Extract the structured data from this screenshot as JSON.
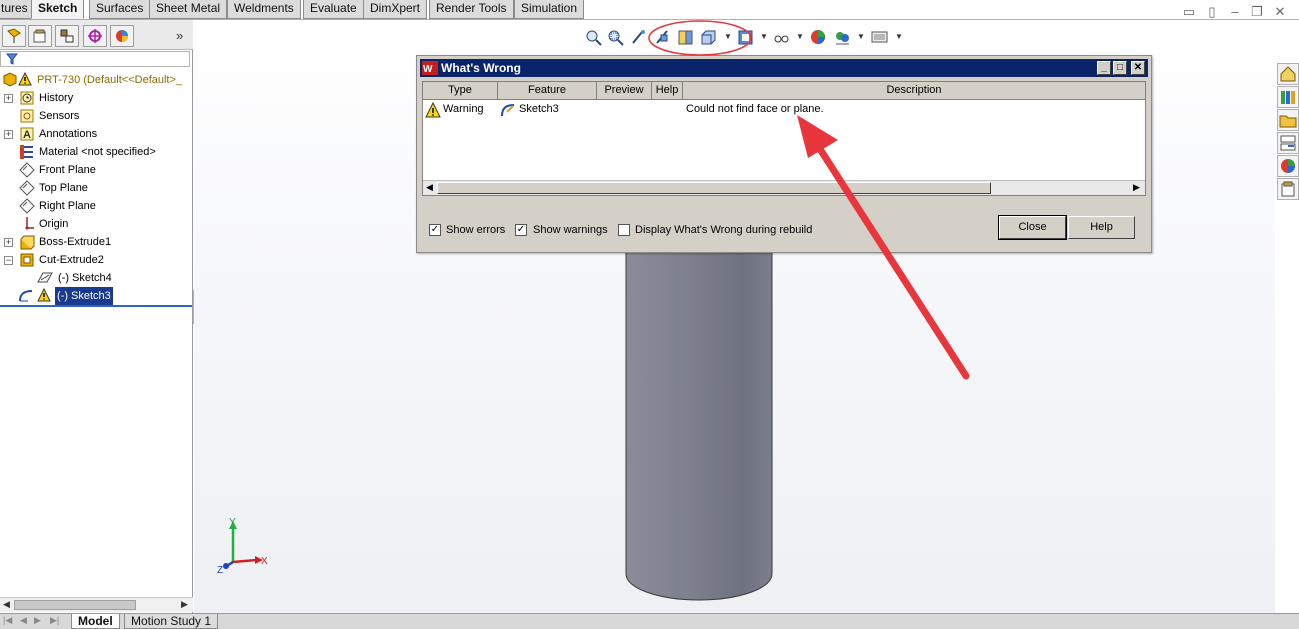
{
  "tabs": [
    {
      "label": "tures"
    },
    {
      "label": "Sketch"
    },
    {
      "label": "Surfaces"
    },
    {
      "label": "Sheet Metal"
    },
    {
      "label": "Weldments"
    },
    {
      "label": "Evaluate"
    },
    {
      "label": "DimXpert"
    },
    {
      "label": "Render Tools"
    },
    {
      "label": "Simulation"
    }
  ],
  "active_tab": "Sketch",
  "feature_tree": {
    "root": "PRT-730  (Default<<Default>_",
    "items": [
      {
        "label": "History",
        "icon": "history-icon"
      },
      {
        "label": "Sensors",
        "icon": "sensors-icon"
      },
      {
        "label": "Annotations",
        "icon": "annotations-icon"
      },
      {
        "label": "Material <not specified>",
        "icon": "material-icon"
      },
      {
        "label": "Front Plane",
        "icon": "plane-icon"
      },
      {
        "label": "Top Plane",
        "icon": "plane-icon"
      },
      {
        "label": "Right Plane",
        "icon": "plane-icon"
      },
      {
        "label": "Origin",
        "icon": "origin-icon"
      },
      {
        "label": "Boss-Extrude1",
        "icon": "extrude-icon"
      },
      {
        "label": "Cut-Extrude2",
        "icon": "cut-extrude-icon"
      },
      {
        "label": "(-) Sketch4",
        "icon": "sketch-icon"
      },
      {
        "label": "(-) Sketch3",
        "icon": "sketch-icon"
      }
    ]
  },
  "dialog": {
    "title": "What's Wrong",
    "columns": [
      "Type",
      "Feature",
      "Preview",
      "Help",
      "Description"
    ],
    "rows": [
      {
        "type": "Warning",
        "feature": "Sketch3",
        "preview": "",
        "help": "",
        "description": "Could not find face or plane."
      }
    ],
    "checkboxes": [
      {
        "label": "Show errors",
        "checked": true
      },
      {
        "label": "Show warnings",
        "checked": true
      },
      {
        "label": "Display What's Wrong during rebuild",
        "checked": false
      }
    ],
    "close_label": "Close",
    "help_label": "Help"
  },
  "triad": {
    "x": "X",
    "y": "Y",
    "z": "Z"
  },
  "bottom_tabs": [
    {
      "label": "Model"
    },
    {
      "label": "Motion Study 1"
    }
  ],
  "colors": {
    "title_bar": "#0a246a",
    "annotation_red": "#e8363c",
    "selection": "#1a3a8f",
    "cylinder": "#7b7e8c"
  }
}
